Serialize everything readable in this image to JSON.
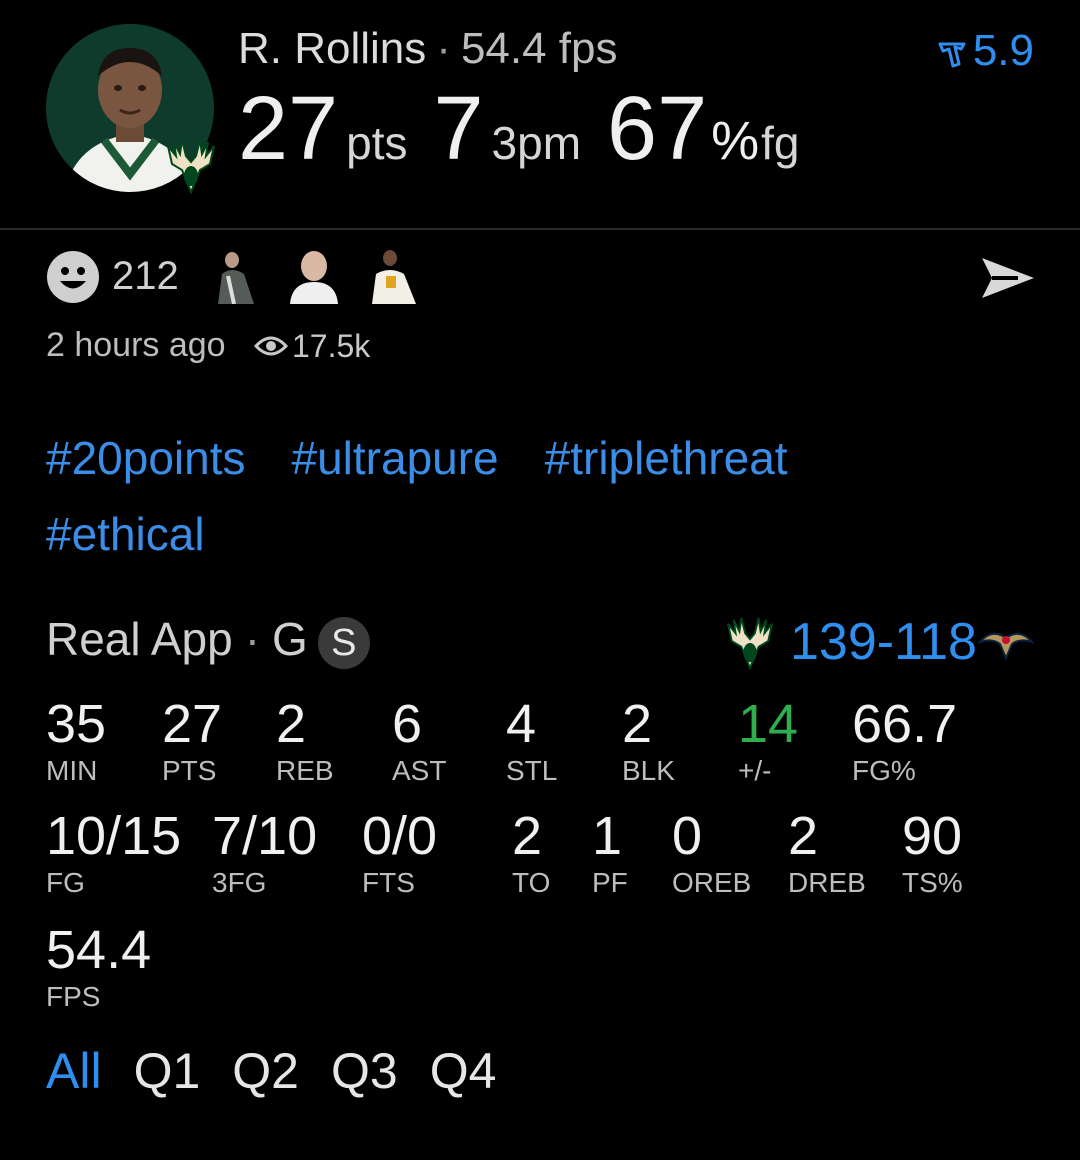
{
  "header": {
    "player_name": "R. Rollins",
    "fps_label": "54.4 fps",
    "rank_value": "5.9",
    "points": "27",
    "points_unit": "pts",
    "threes": "7",
    "threes_unit": "3pm",
    "fg_pct": "67",
    "fg_unit_pct": "%",
    "fg_unit": "fg"
  },
  "social": {
    "reaction_count": "212",
    "time_ago": "2 hours ago",
    "views": "17.5k"
  },
  "tags": [
    "#20points",
    "#ultrapure",
    "#triplethreat",
    "#ethical"
  ],
  "game": {
    "source": "Real App",
    "position": "G",
    "badge": "S",
    "score": "139-118"
  },
  "stats_row1": [
    {
      "value": "35",
      "label": "MIN"
    },
    {
      "value": "27",
      "label": "PTS"
    },
    {
      "value": "2",
      "label": "REB"
    },
    {
      "value": "6",
      "label": "AST"
    },
    {
      "value": "4",
      "label": "STL"
    },
    {
      "value": "2",
      "label": "BLK"
    },
    {
      "value": "14",
      "label": "+/-"
    },
    {
      "value": "66.7",
      "label": "FG%"
    }
  ],
  "stats_row2": [
    {
      "value": "10/15",
      "label": "FG"
    },
    {
      "value": "7/10",
      "label": "3FG"
    },
    {
      "value": "0/0",
      "label": "FTS"
    },
    {
      "value": "2",
      "label": "TO"
    },
    {
      "value": "1",
      "label": "PF"
    },
    {
      "value": "0",
      "label": "OREB"
    },
    {
      "value": "2",
      "label": "DREB"
    },
    {
      "value": "90",
      "label": "TS%"
    }
  ],
  "stats_row3": [
    {
      "value": "54.4",
      "label": "FPS"
    }
  ],
  "quarter_tabs": [
    "All",
    "Q1",
    "Q2",
    "Q3",
    "Q4"
  ],
  "colors": {
    "accent": "#2f8ff0",
    "positive": "#2fae4e",
    "background": "#000000",
    "bucks_green": "#00471b"
  }
}
